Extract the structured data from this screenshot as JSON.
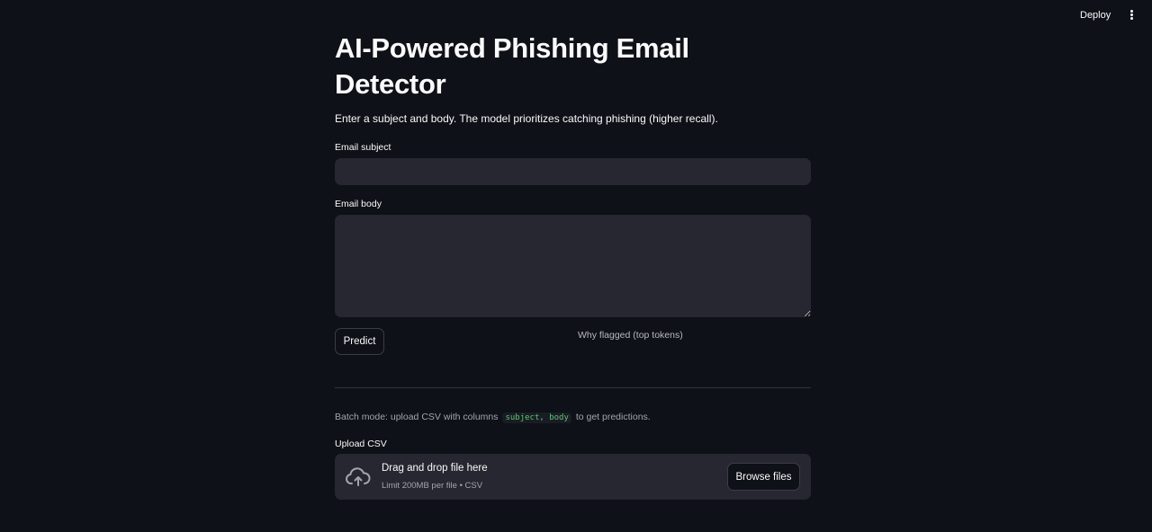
{
  "header": {
    "deploy_label": "Deploy",
    "menu_icon": "kebab-menu-icon"
  },
  "main": {
    "title": "AI-Powered Phishing Email Detector",
    "intro": "Enter a subject and body. The model prioritizes catching phishing (higher recall).",
    "subject_label": "Email subject",
    "subject_value": "",
    "body_label": "Email body",
    "body_value": "",
    "predict_label": "Predict",
    "why_flagged_label": "Why flagged (top tokens)"
  },
  "batch": {
    "text_before": "Batch mode: upload CSV with columns",
    "columns_code": "subject, body",
    "text_after": "to get predictions.",
    "upload_label": "Upload CSV",
    "dropzone_title": "Drag and drop file here",
    "dropzone_limit": "Limit 200MB per file • CSV",
    "browse_label": "Browse files",
    "upload_icon": "cloud-upload-icon"
  },
  "colors": {
    "background": "#0e1117",
    "input_bg": "#262730",
    "text": "#fafafa",
    "muted_text": "#a3a5ab",
    "code_text": "#5ec27a"
  }
}
